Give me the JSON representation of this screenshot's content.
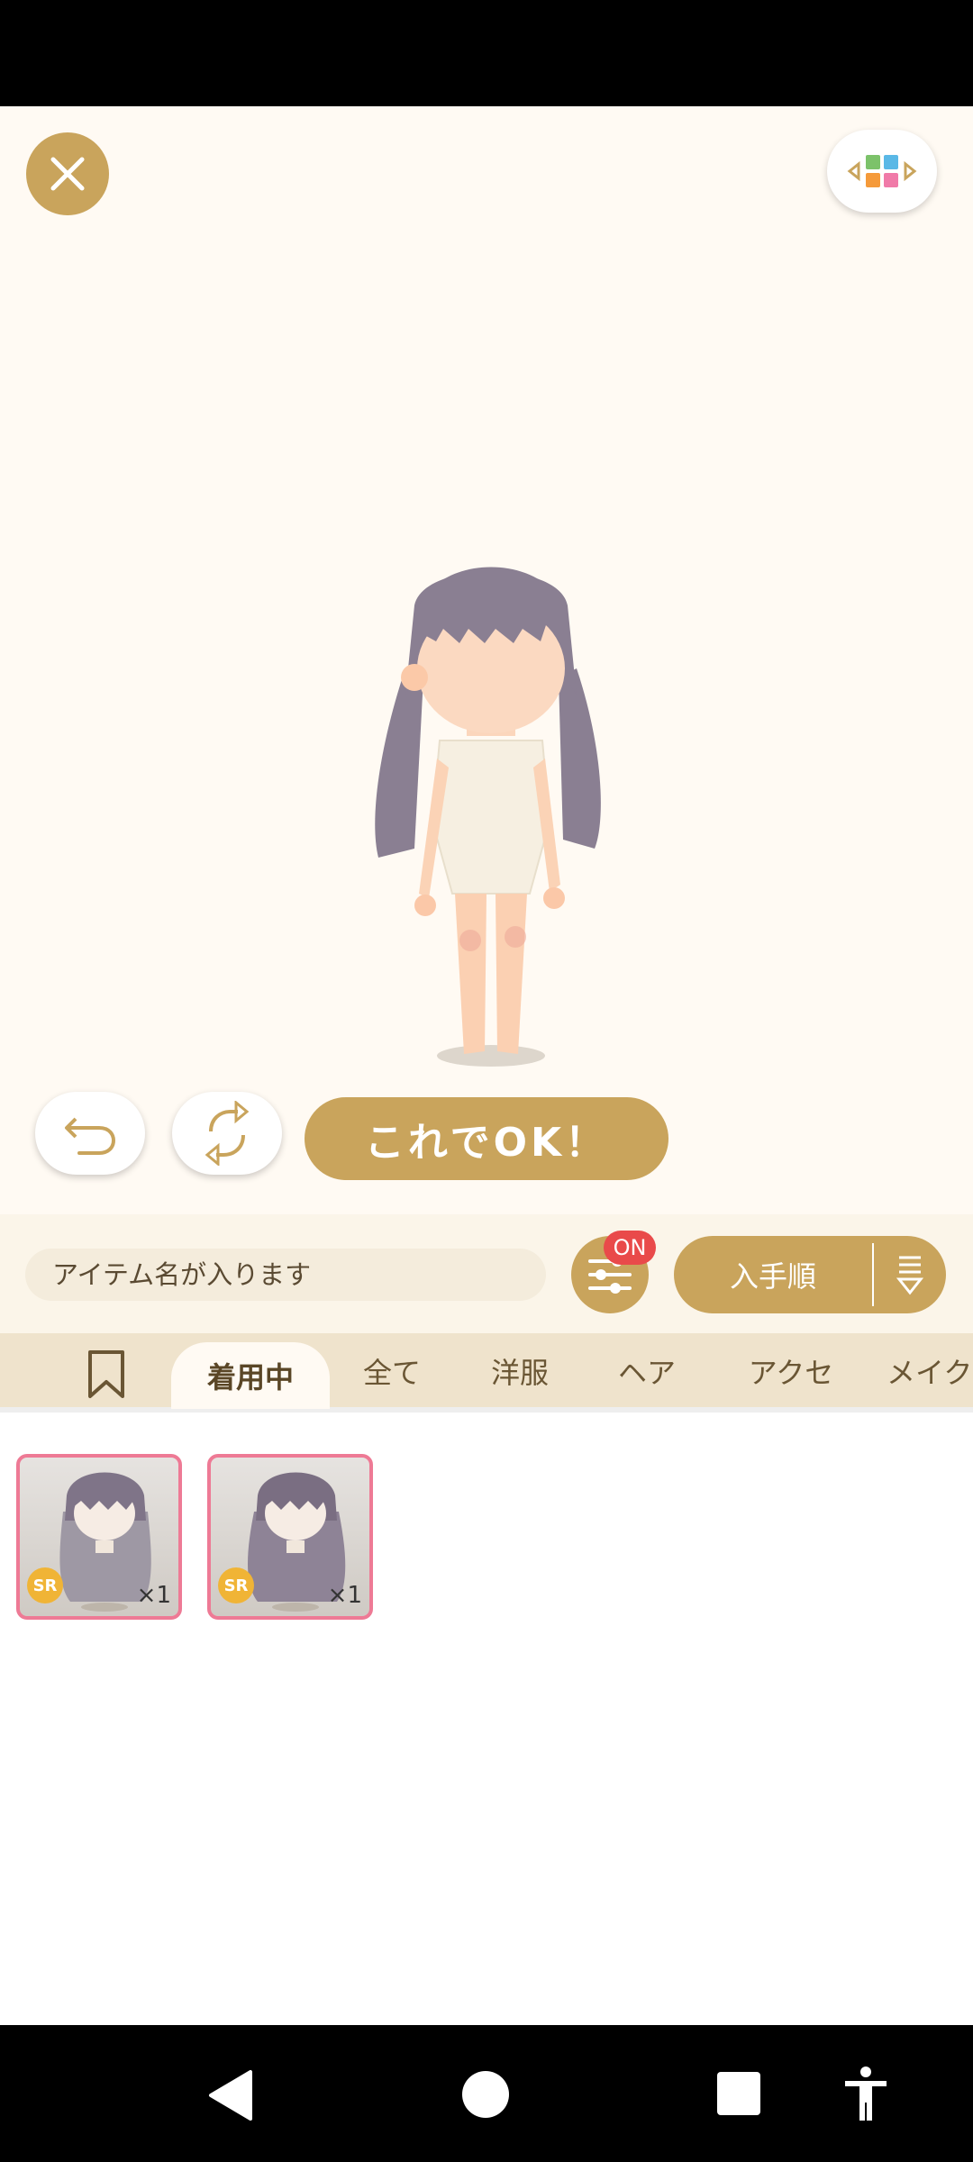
{
  "ok_button": {
    "label": "これでOK！"
  },
  "search": {
    "placeholder": "アイテム名が入ります"
  },
  "filter": {
    "badge": "ON"
  },
  "sort": {
    "label": "入手順"
  },
  "tabs": [
    {
      "label": "着用中",
      "active": true
    },
    {
      "label": "全て"
    },
    {
      "label": "洋服"
    },
    {
      "label": "ヘア"
    },
    {
      "label": "アクセ"
    },
    {
      "label": "メイク"
    }
  ],
  "items": [
    {
      "rarity": "SR",
      "count": "×1"
    },
    {
      "rarity": "SR",
      "count": "×1"
    }
  ],
  "colors": {
    "accent": "#c9a45c",
    "badge_red": "#e94a4a",
    "card_border": "#ee7a95"
  },
  "icons": [
    "close-icon",
    "layout-switch-icon",
    "undo-icon",
    "shuffle-icon",
    "filter-sliders-icon",
    "sort-icon",
    "bookmark-icon",
    "back-icon",
    "home-icon",
    "recents-icon",
    "accessibility-icon"
  ]
}
